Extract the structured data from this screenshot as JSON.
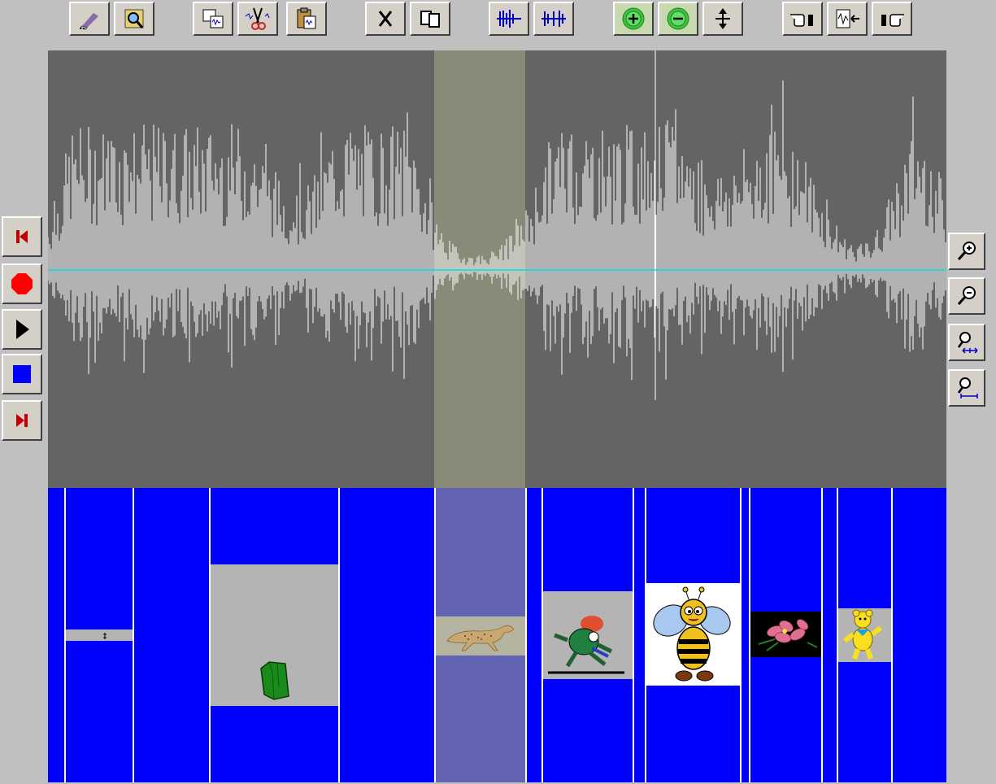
{
  "app": {
    "background": "#c0c0c0",
    "wave_bg": "#646464",
    "wave_color": "#ffffff",
    "axis_color": "#00e0e0",
    "clip_bg": "#0000ff",
    "selection_color": "#8a8a78"
  },
  "toolbar": {
    "buttons": [
      {
        "name": "eraser-button",
        "icon": "eraser-icon"
      },
      {
        "name": "find-button",
        "icon": "magnifier-folder-icon"
      },
      {
        "name": "copy-clip-button",
        "icon": "copy-wave-icon"
      },
      {
        "name": "cut-clip-button",
        "icon": "scissors-icon"
      },
      {
        "name": "paste-clip-button",
        "icon": "clipboard-icon"
      },
      {
        "name": "delete-button",
        "icon": "x-icon"
      },
      {
        "name": "duplicate-button",
        "icon": "duplicate-icon"
      },
      {
        "name": "insert-silence-button",
        "icon": "wave-insert-icon"
      },
      {
        "name": "split-wave-button",
        "icon": "wave-split-icon"
      },
      {
        "name": "volume-up-button",
        "icon": "plus-circle-icon"
      },
      {
        "name": "volume-down-button",
        "icon": "minus-circle-icon"
      },
      {
        "name": "normalize-button",
        "icon": "up-down-arrows-icon"
      },
      {
        "name": "point-left-button",
        "icon": "hand-left-icon"
      },
      {
        "name": "trim-button",
        "icon": "wave-trim-icon"
      },
      {
        "name": "point-right-button",
        "icon": "hand-right-icon"
      }
    ]
  },
  "transport": {
    "buttons": [
      {
        "name": "go-to-start-button",
        "icon": "skip-start-icon"
      },
      {
        "name": "record-button",
        "icon": "record-icon"
      },
      {
        "name": "play-button",
        "icon": "play-icon"
      },
      {
        "name": "stop-button",
        "icon": "stop-icon"
      },
      {
        "name": "go-to-end-button",
        "icon": "skip-end-icon"
      }
    ]
  },
  "zoom": {
    "buttons": [
      {
        "name": "zoom-in-button",
        "icon": "zoom-in-icon"
      },
      {
        "name": "zoom-out-button",
        "icon": "zoom-out-icon"
      },
      {
        "name": "zoom-selection-button",
        "icon": "zoom-fit-icon"
      },
      {
        "name": "zoom-all-button",
        "icon": "zoom-full-icon"
      }
    ]
  },
  "clips": [
    {
      "name": "clip-1",
      "thumb": "small-label-thumb",
      "bg": "#b4b4b4"
    },
    {
      "name": "clip-2",
      "thumb": "green-bag-thumb",
      "bg": "#b4b4b4"
    },
    {
      "name": "clip-3",
      "thumb": "cheetah-thumb",
      "bg": "#b4b4b4"
    },
    {
      "name": "clip-4",
      "thumb": "cartoon-runner-thumb",
      "bg": "#b4b4b4"
    },
    {
      "name": "clip-5",
      "thumb": "bee-thumb",
      "bg": "#ffffff"
    },
    {
      "name": "clip-6",
      "thumb": "flowers-thumb",
      "bg": "#000000"
    },
    {
      "name": "clip-7",
      "thumb": "yellow-bear-thumb",
      "bg": "#b4b4b4"
    }
  ]
}
